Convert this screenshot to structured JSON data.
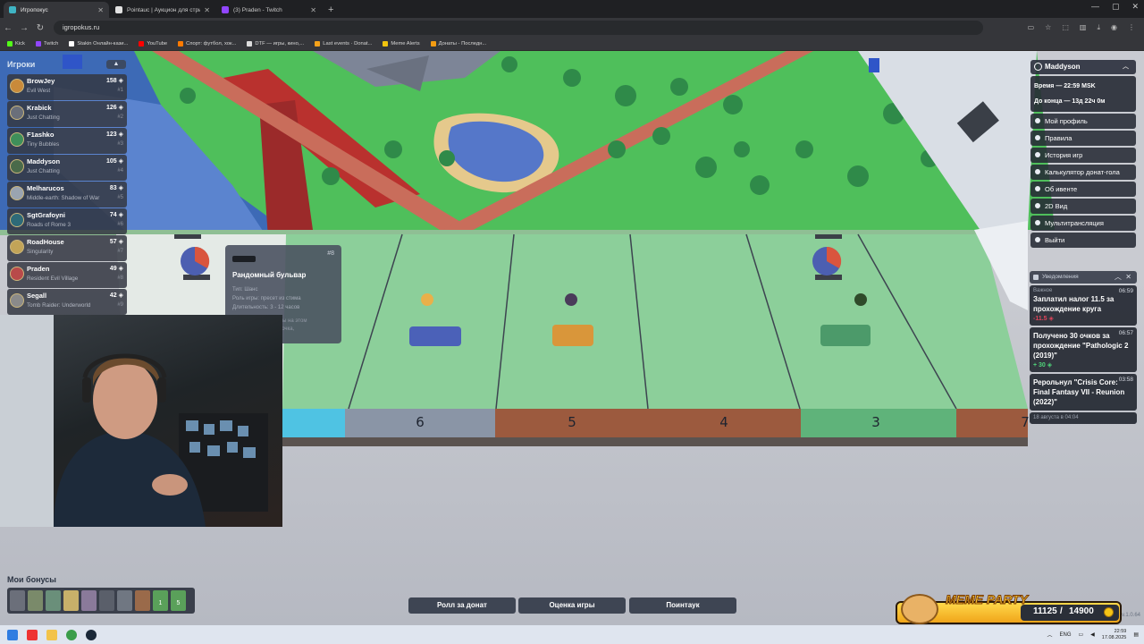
{
  "browser": {
    "tabs": [
      {
        "label": "Игропокус",
        "active": true,
        "color": "#3fb4c4"
      },
      {
        "label": "Pointauc | Аукцион для стрим...",
        "active": false,
        "color": "#e2e2e2"
      },
      {
        "label": "(3) Praden - Twitch",
        "active": false,
        "color": "#9146ff"
      }
    ],
    "new_tab": "+",
    "url": "igropokus.ru",
    "bookmarks": [
      {
        "label": "Kick",
        "color": "#53fc18"
      },
      {
        "label": "Twitch",
        "color": "#9146ff"
      },
      {
        "label": "Stakin Онлайн-кази...",
        "color": "#ffffff"
      },
      {
        "label": "YouTube",
        "color": "#ff0000"
      },
      {
        "label": "Спорт: футбол, хок...",
        "color": "#ff7a00"
      },
      {
        "label": "DTF — игры, кино,...",
        "color": "#dddddd"
      },
      {
        "label": "Last events · Donat...",
        "color": "#f4a21a"
      },
      {
        "label": "Meme Alerts",
        "color": "#f1c40f"
      },
      {
        "label": "Донаты - Последн...",
        "color": "#f39c12"
      }
    ]
  },
  "players": {
    "title": "Игроки",
    "collapse": "▲",
    "list": [
      {
        "name": "BrowJey",
        "game": "Evil West",
        "score": "158",
        "rank": "#1",
        "color": "#c98a3a"
      },
      {
        "name": "Krabick",
        "game": "Just Chatting",
        "score": "126",
        "rank": "#2",
        "color": "#6a6f7a"
      },
      {
        "name": "F1ashko",
        "game": "Tiny Bubbles",
        "score": "123",
        "rank": "#3",
        "color": "#3f8f5a"
      },
      {
        "name": "Maddyson",
        "game": "Just Chatting",
        "score": "105",
        "rank": "#4",
        "color": "#4a6a4a"
      },
      {
        "name": "Melharucos",
        "game": "Middle-earth: Shadow of War",
        "score": "83",
        "rank": "#5",
        "color": "#9aa4b0"
      },
      {
        "name": "SgtGrafoyni",
        "game": "Roads of Rome 3",
        "score": "74",
        "rank": "#6",
        "color": "#2e6a78"
      },
      {
        "name": "RoadHouse",
        "game": "Singularity",
        "score": "57",
        "rank": "#7",
        "color": "#c2a458"
      },
      {
        "name": "Praden",
        "game": "Resident Evil Village",
        "score": "49",
        "rank": "#8",
        "color": "#b84a4a"
      },
      {
        "name": "Segall",
        "game": "Tomb Raider: Underworld",
        "score": "42",
        "rank": "#9",
        "color": "#8a8a8a"
      }
    ]
  },
  "tooltip": {
    "number": "#8",
    "title": "Рандомный бульвар",
    "type": "Тип: Шанс",
    "role": "Роль игры: пресет из стима",
    "duration": "Длительность: 3 - 12 часов",
    "note": "За прохождение игры на этом\nполе выдаётся карточка,\n+2 к бонусу"
  },
  "board": {
    "cells": [
      "6",
      "5",
      "4",
      "3",
      "7"
    ]
  },
  "user_panel": {
    "user": "Maddyson",
    "time": "Время — 22:59 MSK",
    "countdown": "До конца — 13д 22ч 0м",
    "menu": [
      "Мой профиль",
      "Правила",
      "История игр",
      "Калькулятор донат-гола",
      "Об ивенте",
      "2D Вид",
      "Мультитрансляция",
      "Выйти"
    ]
  },
  "notifications": {
    "title": "Уведомления",
    "items": [
      {
        "tag": "Важное",
        "time": "06:59",
        "text": "Заплатил налог 11.5 за прохождение круга",
        "value": "-11.5",
        "value_color": "#e0445a"
      },
      {
        "tag": "",
        "time": "06:57",
        "text": "Получено 30 очков за прохождение \"Pathologic 2 (2019)\"",
        "value": "+ 30",
        "value_color": "#4fd37a"
      },
      {
        "tag": "",
        "time": "03:58",
        "text": "Рерольнул \"Crisis Core: Final Fantasy VII - Reunion (2022)\"",
        "value": "",
        "value_color": "#ffffff"
      },
      {
        "tag": "18 августа в 04:04",
        "time": "",
        "text": "",
        "value": "",
        "value_color": "#ffffff"
      }
    ]
  },
  "bonuses": {
    "title": "Мои бонусы",
    "slot_colors": [
      "#6b6f7a",
      "#7a8a6a",
      "#6a8f7a",
      "#c8b06a",
      "#8a7a9a",
      "#5a5f6a",
      "#707782",
      "#9a6a4a",
      "#5aa05a",
      "#5aa05a"
    ],
    "slot_labels": [
      "",
      "",
      "",
      "",
      "",
      "",
      "",
      "",
      "1",
      "5"
    ]
  },
  "buttons": {
    "roll": "Ролл за донат",
    "rate": "Оценка игры",
    "pointauc": "Поинтаук"
  },
  "meme_party": {
    "title": "MEME PARTY",
    "current": "11125",
    "separator": "/",
    "goal": "14900"
  },
  "version": "v.1.0.64",
  "taskbar": {
    "lang": "ENG",
    "time": "22:59",
    "date": "17.08.2025"
  }
}
